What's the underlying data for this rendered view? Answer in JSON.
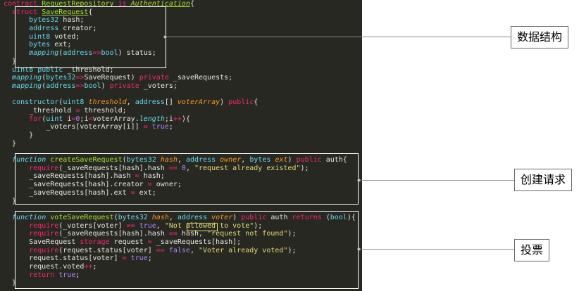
{
  "code_lines": [
    [
      [
        "k",
        "contract "
      ],
      [
        "ty",
        "RequestRepository"
      ],
      [
        "",
        " "
      ],
      [
        "k",
        "is "
      ],
      [
        "ti",
        "Authentication"
      ],
      [
        "",
        "{"
      ]
    ],
    [
      [
        "",
        "  "
      ],
      [
        "k",
        "struct "
      ],
      [
        "ty",
        "SaveRequest"
      ],
      [
        "",
        "{"
      ]
    ],
    [
      [
        "",
        "      "
      ],
      [
        "c",
        "bytes32"
      ],
      [
        "",
        " hash;"
      ]
    ],
    [
      [
        "",
        "      "
      ],
      [
        "c",
        "address"
      ],
      [
        "",
        " creator;"
      ]
    ],
    [
      [
        "",
        "      "
      ],
      [
        "c",
        "uint8"
      ],
      [
        "",
        " voted;"
      ]
    ],
    [
      [
        "",
        "      "
      ],
      [
        "c",
        "bytes"
      ],
      [
        "",
        " ext;"
      ]
    ],
    [
      [
        "",
        "      "
      ],
      [
        "t",
        "mapping"
      ],
      [
        "",
        "("
      ],
      [
        "c",
        "address"
      ],
      [
        "k",
        "=>"
      ],
      [
        "c",
        "bool"
      ],
      [
        "",
        ") status;"
      ]
    ],
    [
      [
        "",
        "  }"
      ]
    ],
    [
      [
        "",
        "  "
      ],
      [
        "c",
        "uint8"
      ],
      [
        "",
        " "
      ],
      [
        "c",
        "public"
      ],
      [
        "",
        " _threshold;"
      ]
    ],
    [
      [
        "",
        "  "
      ],
      [
        "t",
        "mapping"
      ],
      [
        "",
        "("
      ],
      [
        "c",
        "bytes32"
      ],
      [
        "k",
        "=>"
      ],
      [
        "",
        "SaveRequest) "
      ],
      [
        "k",
        "private"
      ],
      [
        "",
        " _saveRequests;"
      ]
    ],
    [
      [
        "",
        "  "
      ],
      [
        "t",
        "mapping"
      ],
      [
        "",
        "("
      ],
      [
        "c",
        "address"
      ],
      [
        "k",
        "=>"
      ],
      [
        "c",
        "bool"
      ],
      [
        "",
        ") "
      ],
      [
        "k",
        "private"
      ],
      [
        "",
        " _voters;"
      ]
    ],
    [
      [
        "",
        ""
      ]
    ],
    [
      [
        "",
        "  "
      ],
      [
        "c",
        "constructor"
      ],
      [
        "",
        "("
      ],
      [
        "c",
        "uint8"
      ],
      [
        "",
        " "
      ],
      [
        "p",
        "threshold"
      ],
      [
        "",
        ", "
      ],
      [
        "c",
        "address"
      ],
      [
        "",
        "[] "
      ],
      [
        "p",
        "voterArray"
      ],
      [
        "",
        ") "
      ],
      [
        "k",
        "public"
      ],
      [
        "",
        "{"
      ]
    ],
    [
      [
        "",
        "      _threshold "
      ],
      [
        "k",
        "="
      ],
      [
        "",
        " threshold;"
      ]
    ],
    [
      [
        "",
        "      "
      ],
      [
        "k",
        "for"
      ],
      [
        "",
        "("
      ],
      [
        "c",
        "uint"
      ],
      [
        "",
        " i"
      ],
      [
        "k",
        "="
      ],
      [
        "n",
        "0"
      ],
      [
        "",
        ";i"
      ],
      [
        "k",
        "<"
      ],
      [
        "",
        "voterArray."
      ],
      [
        "t",
        "length"
      ],
      [
        "",
        ";i"
      ],
      [
        "k",
        "++"
      ],
      [
        "",
        "){"
      ]
    ],
    [
      [
        "",
        "          _voters[voterArray[i]] "
      ],
      [
        "k",
        "="
      ],
      [
        "",
        " "
      ],
      [
        "n",
        "true"
      ],
      [
        "",
        ";"
      ]
    ],
    [
      [
        "",
        "      }"
      ]
    ],
    [
      [
        "",
        "  }"
      ]
    ],
    [
      [
        "",
        ""
      ]
    ],
    [
      [
        "",
        "  "
      ],
      [
        "t",
        "function"
      ],
      [
        "",
        " "
      ],
      [
        "f",
        "createSaveRequest"
      ],
      [
        "",
        "("
      ],
      [
        "c",
        "bytes32"
      ],
      [
        "",
        " "
      ],
      [
        "p",
        "hash"
      ],
      [
        "",
        ", "
      ],
      [
        "c",
        "address"
      ],
      [
        "",
        " "
      ],
      [
        "p",
        "owner"
      ],
      [
        "",
        ", "
      ],
      [
        "c",
        "bytes"
      ],
      [
        "",
        " "
      ],
      [
        "p",
        "ext"
      ],
      [
        "",
        ") "
      ],
      [
        "k",
        "public"
      ],
      [
        "",
        " auth{"
      ]
    ],
    [
      [
        "",
        "      "
      ],
      [
        "k",
        "require"
      ],
      [
        "",
        "(_saveRequests[hash].hash "
      ],
      [
        "k",
        "=="
      ],
      [
        "",
        " "
      ],
      [
        "n",
        "0"
      ],
      [
        "",
        ", "
      ],
      [
        "s",
        "\"request already existed\""
      ],
      [
        "",
        ");"
      ]
    ],
    [
      [
        "",
        "      _saveRequests[hash].hash "
      ],
      [
        "k",
        "="
      ],
      [
        "",
        " hash;"
      ]
    ],
    [
      [
        "",
        "      _saveRequests[hash].creator "
      ],
      [
        "k",
        "="
      ],
      [
        "",
        " owner;"
      ]
    ],
    [
      [
        "",
        "      _saveRequests[hash].ext "
      ],
      [
        "k",
        "="
      ],
      [
        "",
        " ext;"
      ]
    ],
    [
      [
        "",
        "  }"
      ]
    ],
    [
      [
        "",
        ""
      ]
    ],
    [
      [
        "",
        "  "
      ],
      [
        "t",
        "function"
      ],
      [
        "",
        " "
      ],
      [
        "f",
        "voteSaveRequest"
      ],
      [
        "",
        "("
      ],
      [
        "c",
        "bytes32"
      ],
      [
        "",
        " "
      ],
      [
        "p",
        "hash"
      ],
      [
        "",
        ", "
      ],
      [
        "c",
        "address"
      ],
      [
        "",
        " "
      ],
      [
        "p",
        "voter"
      ],
      [
        "",
        ") "
      ],
      [
        "k",
        "public"
      ],
      [
        "",
        " auth "
      ],
      [
        "k",
        "returns"
      ],
      [
        "",
        " ("
      ],
      [
        "c",
        "bool"
      ],
      [
        "",
        "){"
      ]
    ],
    [
      [
        "",
        "      "
      ],
      [
        "k",
        "require"
      ],
      [
        "",
        "(_voters[voter] "
      ],
      [
        "k",
        "=="
      ],
      [
        "",
        " "
      ],
      [
        "n",
        "true"
      ],
      [
        "",
        ", "
      ],
      [
        "s",
        "\"Not allowed to vote\""
      ],
      [
        "",
        ");"
      ]
    ],
    [
      [
        "",
        "      "
      ],
      [
        "k",
        "require"
      ],
      [
        "",
        "(_saveRequests[hash].hash "
      ],
      [
        "k",
        "=="
      ],
      [
        "",
        " hash, "
      ],
      [
        "s",
        "\"request not found\""
      ],
      [
        "",
        ");"
      ]
    ],
    [
      [
        "",
        "      SaveRequest "
      ],
      [
        "k",
        "storage"
      ],
      [
        "",
        " request "
      ],
      [
        "k",
        "="
      ],
      [
        "",
        " _saveRequests[hash];"
      ]
    ],
    [
      [
        "",
        "      "
      ],
      [
        "k",
        "require"
      ],
      [
        "",
        "(request.status[voter] "
      ],
      [
        "k",
        "=="
      ],
      [
        "",
        " "
      ],
      [
        "n",
        "false"
      ],
      [
        "",
        ", "
      ],
      [
        "s",
        "\"Voter already voted\""
      ],
      [
        "",
        ");"
      ]
    ],
    [
      [
        "",
        "      request.status[voter] "
      ],
      [
        "k",
        "="
      ],
      [
        "",
        " "
      ],
      [
        "n",
        "true"
      ],
      [
        "",
        ";"
      ]
    ],
    [
      [
        "",
        "      request.voted"
      ],
      [
        "k",
        "++"
      ],
      [
        "",
        ";"
      ]
    ],
    [
      [
        "",
        "      "
      ],
      [
        "k",
        "return"
      ],
      [
        "",
        " "
      ],
      [
        "n",
        "true"
      ],
      [
        "",
        ";"
      ]
    ],
    [
      [
        "",
        "  }"
      ]
    ]
  ],
  "annotations": {
    "data_structure": "数据结构",
    "create_request": "创建请求",
    "vote": "投票"
  },
  "colors": {
    "editor_bg": "#272822",
    "keyword": "#f92672",
    "type": "#66d9ef",
    "function_name": "#a6e22e",
    "string": "#e6db74",
    "number": "#ae81ff",
    "parameter": "#fd971f"
  }
}
